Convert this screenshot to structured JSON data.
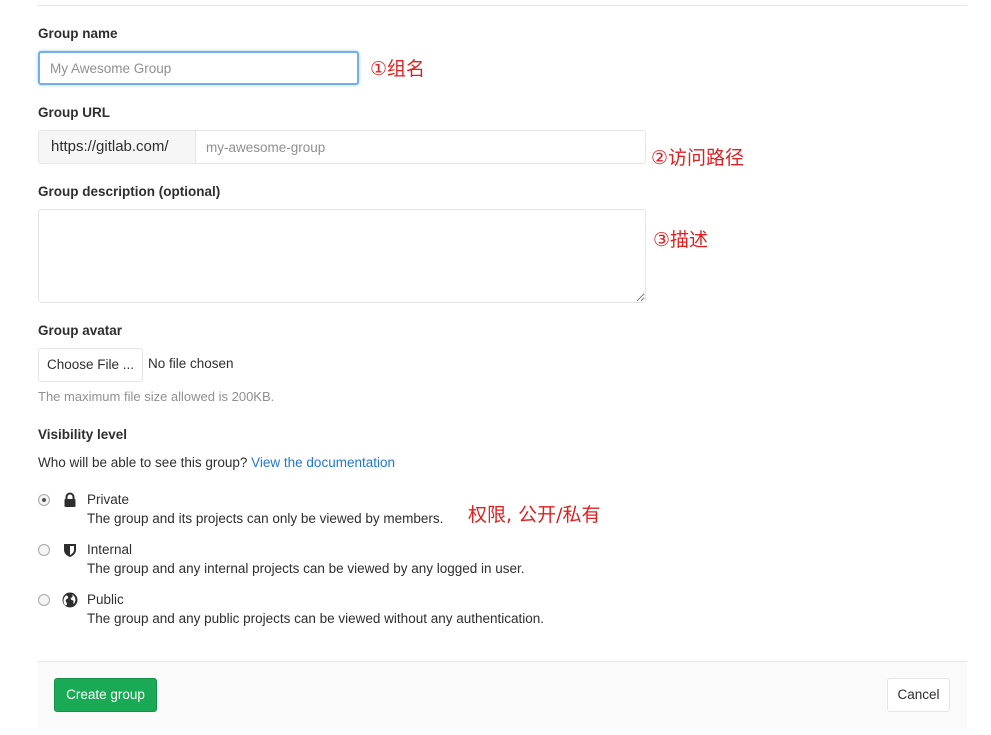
{
  "form": {
    "group_name": {
      "label": "Group name",
      "placeholder": "My Awesome Group",
      "value": ""
    },
    "group_url": {
      "label": "Group URL",
      "prefix": "https://gitlab.com/",
      "placeholder": "my-awesome-group",
      "value": ""
    },
    "description": {
      "label": "Group description (optional)",
      "value": ""
    },
    "avatar": {
      "label": "Group avatar",
      "button": "Choose File ...",
      "status": "No file chosen",
      "help": "The maximum file size allowed is 200KB."
    },
    "visibility": {
      "label": "Visibility level",
      "question": "Who will be able to see this group?",
      "doc_link": "View the documentation",
      "options": [
        {
          "title": "Private",
          "description": "The group and its projects can only be viewed by members.",
          "checked": true,
          "icon": "lock-icon"
        },
        {
          "title": "Internal",
          "description": "The group and any internal projects can be viewed by any logged in user.",
          "checked": false,
          "icon": "shield-icon"
        },
        {
          "title": "Public",
          "description": "The group and any public projects can be viewed without any authentication.",
          "checked": false,
          "icon": "globe-icon"
        }
      ]
    }
  },
  "annotations": {
    "name": "①组名",
    "url": "②访问路径",
    "description": "③描述",
    "visibility": "权限, 公开/私有"
  },
  "footer": {
    "create": "Create group",
    "cancel": "Cancel"
  },
  "colors": {
    "accent": "#1aaa55",
    "link": "#1f78d1",
    "annotation": "#e02020",
    "focus": "#73afea"
  }
}
